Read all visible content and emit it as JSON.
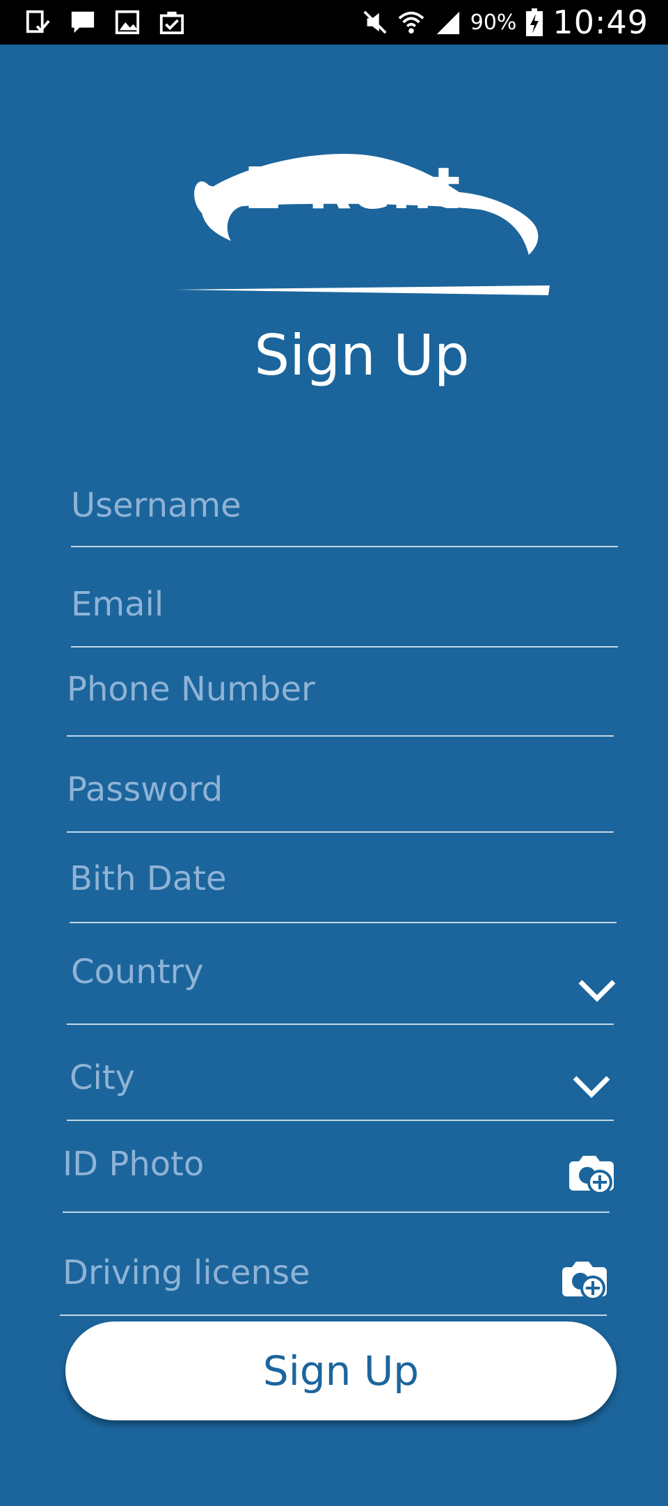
{
  "status_bar": {
    "icons_left": [
      "download-done-icon",
      "message-icon",
      "image-icon",
      "clipboard-check-icon"
    ],
    "icons_right": [
      "mute-icon",
      "wifi-icon",
      "signal-icon",
      "battery-charging-icon"
    ],
    "battery": "90%",
    "time": "10:49"
  },
  "logo": {
    "text": "E-Rent"
  },
  "title": "Sign Up",
  "form": {
    "username": "Username",
    "email": "Email",
    "phone": "Phone Number",
    "password": "Password",
    "birth_date": "Bith Date",
    "country": "Country",
    "city": "City",
    "id_photo": "ID Photo",
    "driving_license": "Driving license"
  },
  "button": {
    "label": "Sign Up"
  },
  "colors": {
    "background": "#1b659c",
    "placeholder": "#8fb3d6",
    "button_bg": "#ffffff",
    "button_text": "#1b659c"
  }
}
